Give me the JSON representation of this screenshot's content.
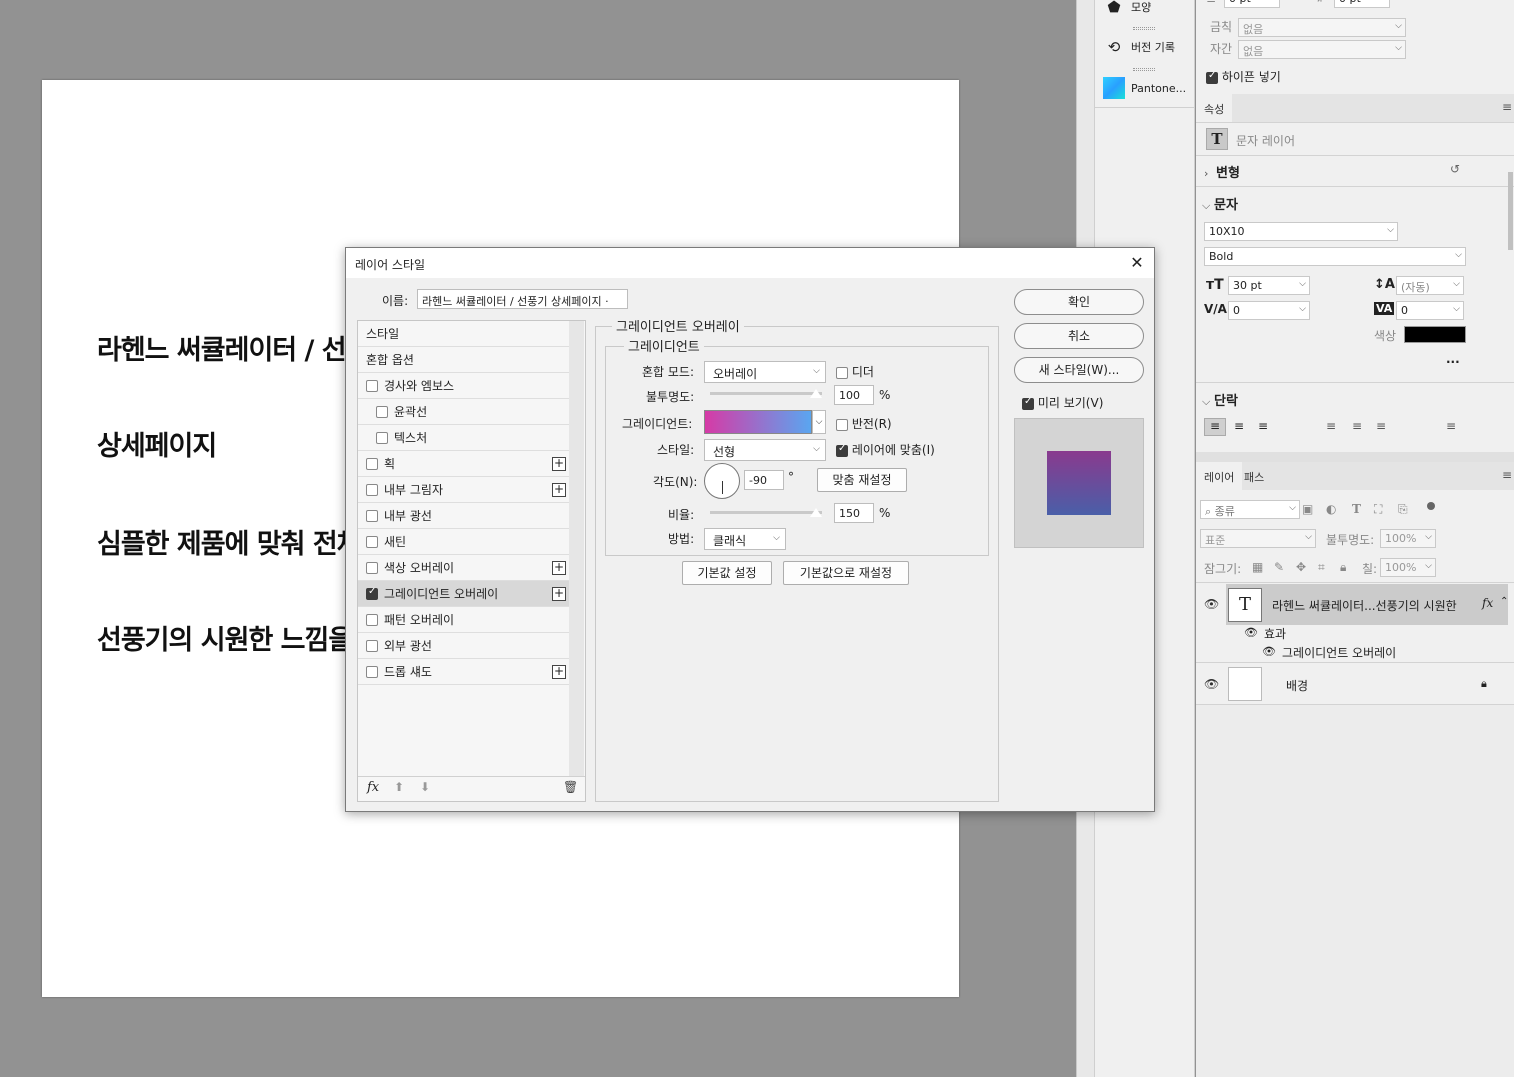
{
  "document": {
    "lines": [
      "라헨느 써큘레이터 / 선",
      "상세페이지",
      "심플한 제품에 맞춰 전체",
      "선풍기의 시원한 느낌을"
    ]
  },
  "mini_panel": {
    "items": [
      {
        "label": "모양",
        "icon": "shape-icon"
      },
      {
        "label": "버전 기록",
        "icon": "history-icon"
      },
      {
        "label": "Pantone...",
        "icon": "pantone-icon"
      }
    ]
  },
  "character_top": {
    "top_values": [
      "0 pt",
      "0 pt"
    ],
    "kerning_label": "금칙",
    "kerning_value": "없음",
    "tracking_label": "자간",
    "tracking_value": "없음",
    "hyphenate_label": "하이픈 넣기"
  },
  "properties": {
    "tab": "속성",
    "layer_type": "문자 레이어",
    "transform_label": "변형",
    "character_label": "문자",
    "font_family": "10X10",
    "font_style": "Bold",
    "font_size": "30 pt",
    "leading": "(자동)",
    "kerning": "0",
    "tracking": "0",
    "color_label": "색상",
    "text_color": "#000000",
    "more": "...",
    "paragraph_label": "단락"
  },
  "layers_panel": {
    "tabs": [
      "레이어",
      "패스"
    ],
    "filter": "종류",
    "blend_mode": "표준",
    "opacity_label": "불투명도:",
    "opacity": "100%",
    "lock_label": "잠그기:",
    "fill_label": "칠:",
    "fill": "100%",
    "layers": [
      {
        "name": "라헨느 써큘레이터...선풍기의 시원한",
        "fx": "fx",
        "effects_label": "효과",
        "effect": "그레이디언트 오버레이"
      },
      {
        "name": "배경"
      }
    ]
  },
  "dialog": {
    "title": "레이어 스타일",
    "close": "✕",
    "name_label": "이름:",
    "name_value": "라헨느 써큘레이터 / 선풍기 상세페이지 ·",
    "style_items": [
      {
        "label": "스타일",
        "check": false,
        "plus": false
      },
      {
        "label": "혼합 옵션",
        "check": false,
        "plus": false
      },
      {
        "label": "경사와 엠보스",
        "check": true,
        "checked": false,
        "plus": false
      },
      {
        "label": "윤곽선",
        "check": true,
        "checked": false,
        "plus": false,
        "indent": true
      },
      {
        "label": "텍스처",
        "check": true,
        "checked": false,
        "plus": false,
        "indent": true
      },
      {
        "label": "획",
        "check": true,
        "checked": false,
        "plus": true
      },
      {
        "label": "내부 그림자",
        "check": true,
        "checked": false,
        "plus": true
      },
      {
        "label": "내부 광선",
        "check": true,
        "checked": false,
        "plus": false
      },
      {
        "label": "새틴",
        "check": true,
        "checked": false,
        "plus": false
      },
      {
        "label": "색상 오버레이",
        "check": true,
        "checked": false,
        "plus": true
      },
      {
        "label": "그레이디언트 오버레이",
        "check": true,
        "checked": true,
        "plus": true,
        "selected": true
      },
      {
        "label": "패턴 오버레이",
        "check": true,
        "checked": false,
        "plus": false
      },
      {
        "label": "외부 광선",
        "check": true,
        "checked": false,
        "plus": false
      },
      {
        "label": "드롭 섀도",
        "check": true,
        "checked": false,
        "plus": true
      }
    ],
    "fx_label": "fx",
    "section_title": "그레이디언트 오버레이",
    "subsection_title": "그레이디언트",
    "blend_mode_label": "혼합 모드:",
    "blend_mode": "오버레이",
    "dither_label": "디더",
    "opacity_label": "불투명도:",
    "opacity": "100",
    "percent": "%",
    "gradient_label": "그레이디언트:",
    "gradient_start": "#d63aa6",
    "gradient_end": "#5aa6f0",
    "reverse_label": "반전(R)",
    "style_label": "스타일:",
    "style_value": "선형",
    "align_label": "레이어에 맞춤(I)",
    "angle_label": "각도(N):",
    "angle": "-90",
    "degree": "°",
    "reset_align": "맞춤 재설정",
    "scale_label": "비율:",
    "scale": "150",
    "method_label": "방법:",
    "method": "클래식",
    "make_default": "기본값 설정",
    "reset_default": "기본값으로 재설정",
    "ok": "확인",
    "cancel": "취소",
    "new_style": "새 스타일(W)...",
    "preview_label": "미리 보기(V)",
    "preview_top": "#8a3a8e",
    "preview_bottom": "#4a5fa8"
  }
}
